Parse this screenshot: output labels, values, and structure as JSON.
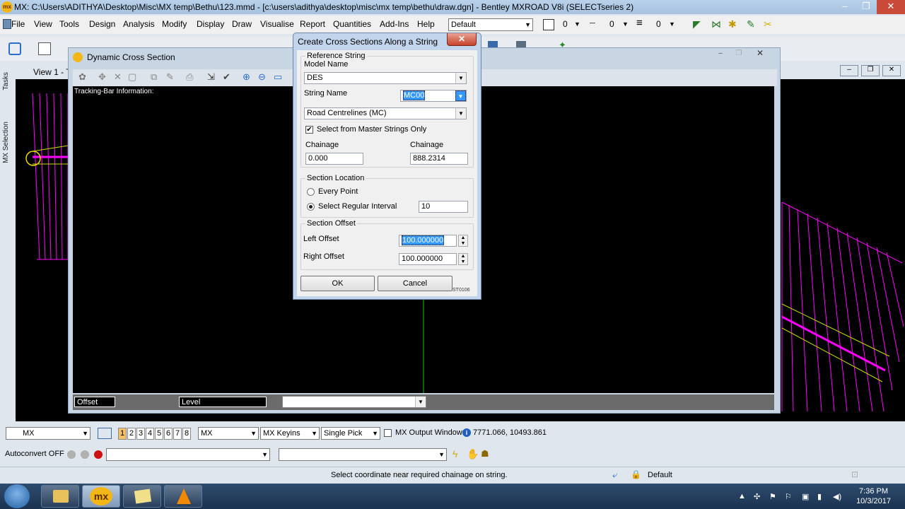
{
  "app": {
    "icon_text": "mx",
    "title": "MX: C:\\Users\\ADITHYA\\Desktop\\Misc\\MX temp\\Bethu\\123.mmd - [c:\\users\\adithya\\desktop\\misc\\mx temp\\bethu\\draw.dgn] - Bentley MXROAD V8i (SELECTseries 2)",
    "window_buttons": [
      "–",
      "❐",
      "✕"
    ]
  },
  "menu": {
    "items": [
      "File",
      "View",
      "Tools",
      "Design",
      "Analysis",
      "Modify",
      "Display",
      "Draw",
      "Visualise",
      "Report",
      "Quantities",
      "Add-Ins",
      "Help"
    ],
    "level_combo": "Default",
    "color_value": "0",
    "style_value": "0",
    "weight_value": "0"
  },
  "left_dock": {
    "tabs": [
      "Tasks",
      "MX Selection"
    ]
  },
  "view": {
    "label": "View 1 - T"
  },
  "dcs_window": {
    "title": "Dynamic Cross Section",
    "tracking_label": "Tracking-Bar Information:",
    "offset_label": "Offset",
    "level_label": "Level"
  },
  "dialog": {
    "title": "Create Cross Sections Along a String",
    "close": "✕",
    "reference_group": "Reference String",
    "model_name_label": "Model Name",
    "model_name_value": "DES",
    "string_name_label": "String Name",
    "string_name_value": "MC00",
    "string_type_value": "Road Centrelines (MC)",
    "master_only_label": "Select from Master Strings Only",
    "master_only_checked": true,
    "chainage_from_label": "Chainage",
    "chainage_from_value": "0.000",
    "chainage_to_label": "Chainage",
    "chainage_to_value": "888.2314",
    "location_group": "Section Location",
    "every_point_label": "Every Point",
    "regular_interval_label": "Select Regular Interval",
    "interval_value": "10",
    "offset_group": "Section Offset",
    "left_offset_label": "Left Offset",
    "left_offset_value": "100.000000",
    "right_offset_label": "Right Offset",
    "right_offset_value": "100.000000",
    "ok_label": "OK",
    "cancel_label": "Cancel",
    "code": "ST0106"
  },
  "bottom": {
    "mx_combo": "MX",
    "view_numbers": [
      "1",
      "2",
      "3",
      "4",
      "5",
      "6",
      "7",
      "8"
    ],
    "mx_combo2": "MX",
    "keyins_combo": "MX Keyins",
    "pick_combo": "Single Pick",
    "output_window_label": "MX Output Window",
    "coords": "7771.066, 10493.861",
    "autoconvert": "Autoconvert OFF",
    "prompt": "Select coordinate near required chainage on string.",
    "status_level": "Default"
  },
  "taskbar": {
    "time": "7:36 PM",
    "date": "10/3/2017",
    "mx_label": "mx"
  },
  "colors": {
    "magenta": "#ff00ff",
    "yellow_green": "#c8e000",
    "green_line": "#00cc00"
  }
}
